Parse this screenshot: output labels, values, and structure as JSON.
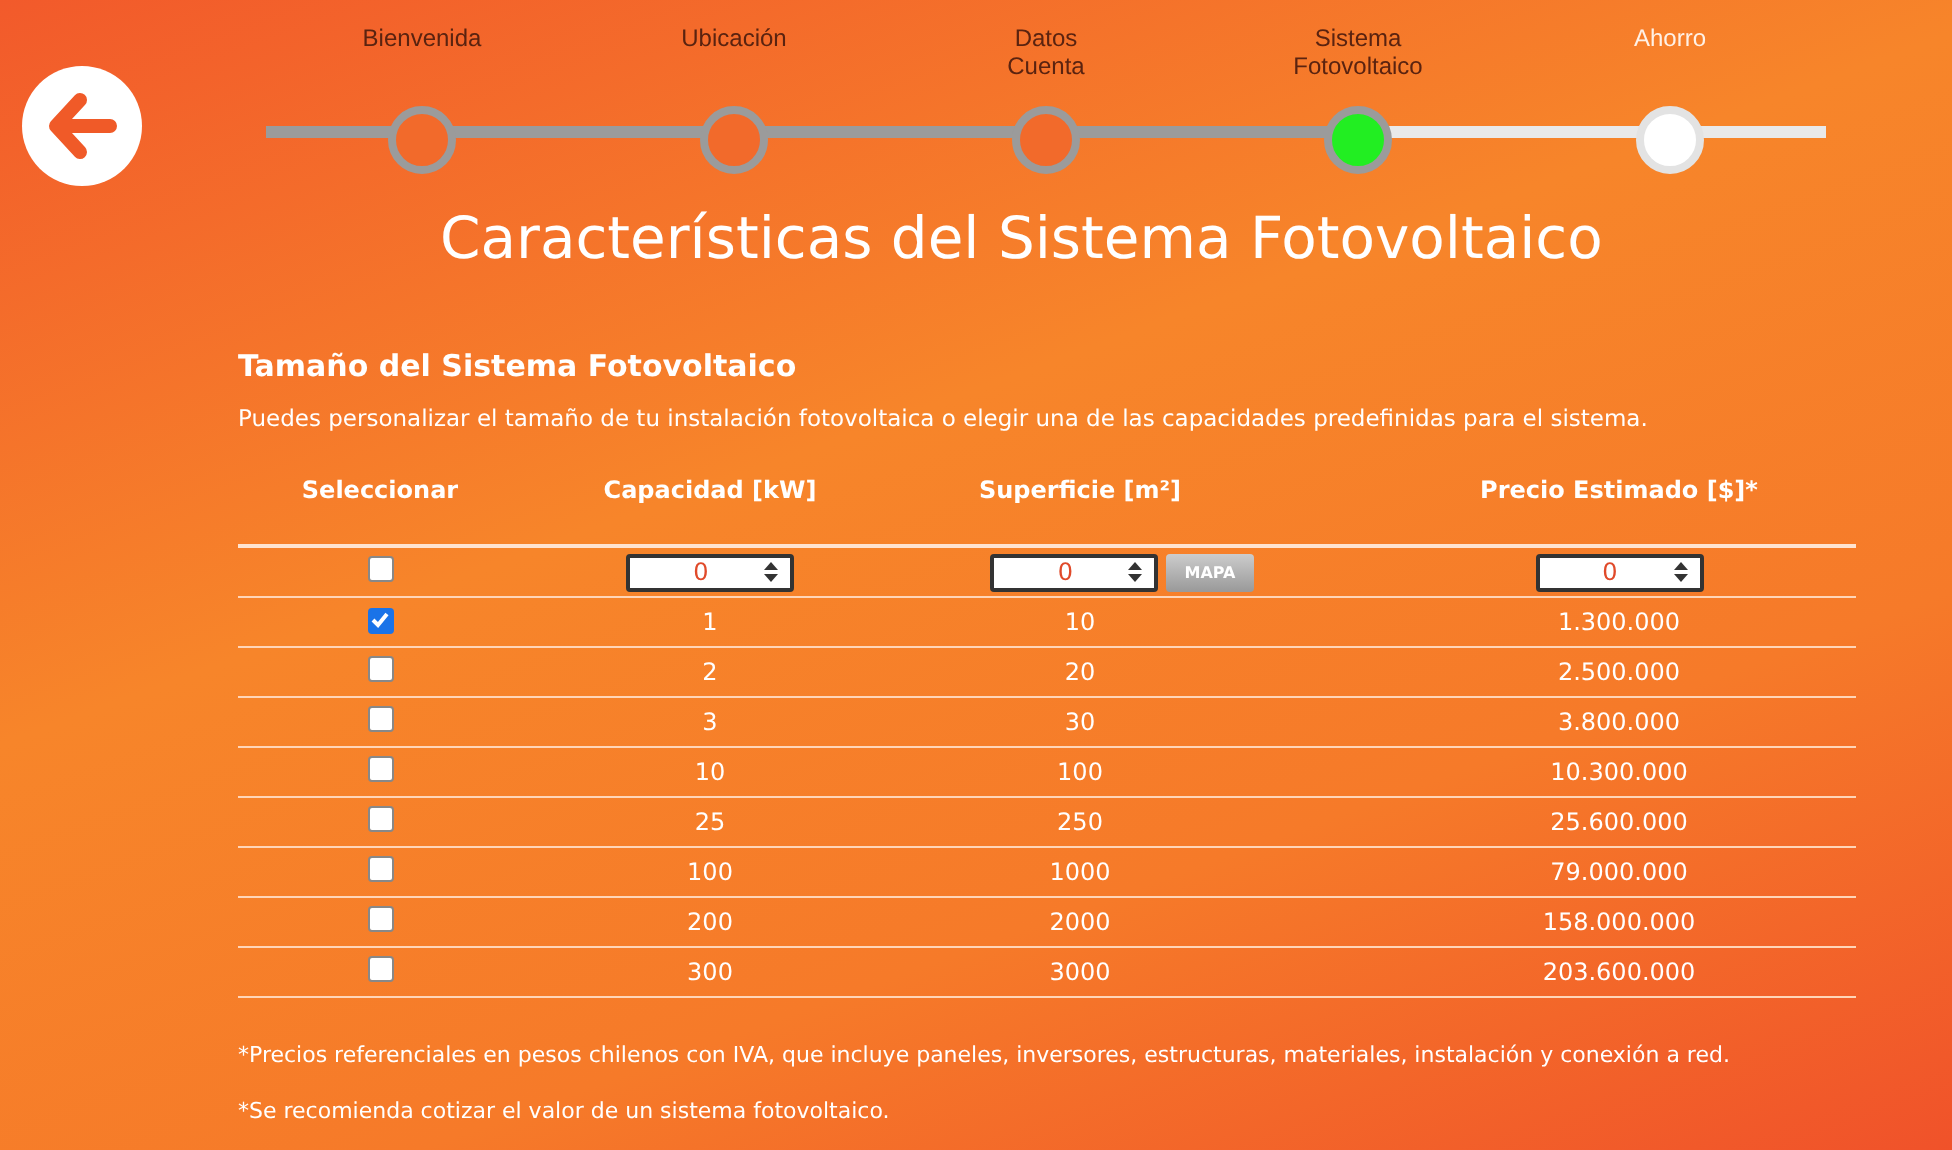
{
  "steps": [
    {
      "label": "Bienvenida",
      "completed": true,
      "selected": false
    },
    {
      "label": "Ubicación",
      "completed": true,
      "selected": false
    },
    {
      "label": "Datos Cuenta",
      "completed": true,
      "selected": false
    },
    {
      "label": "Sistema Fotovoltaico",
      "completed": false,
      "selected": true
    },
    {
      "label": "Ahorro",
      "completed": false,
      "selected": false
    }
  ],
  "title": "Características del Sistema Fotovoltaico",
  "section": {
    "heading": "Tamaño del Sistema Fotovoltaico",
    "description": "Puedes personalizar el tamaño de tu instalación fotovoltaica o elegir una de las capacidades predefinidas para el sistema."
  },
  "table": {
    "columns": [
      "Seleccionar",
      "Capacidad [kW]",
      "Superficie [m²]",
      "Precio Estimado [$]*"
    ],
    "custom_row": {
      "checked": false,
      "capacity": "0",
      "surface": "0",
      "map_button": "MAPA",
      "price": "0"
    },
    "rows": [
      {
        "checked": true,
        "capacity": "1",
        "surface": "10",
        "price": "1.300.000"
      },
      {
        "checked": false,
        "capacity": "2",
        "surface": "20",
        "price": "2.500.000"
      },
      {
        "checked": false,
        "capacity": "3",
        "surface": "30",
        "price": "3.800.000"
      },
      {
        "checked": false,
        "capacity": "10",
        "surface": "100",
        "price": "10.300.000"
      },
      {
        "checked": false,
        "capacity": "25",
        "surface": "250",
        "price": "25.600.000"
      },
      {
        "checked": false,
        "capacity": "100",
        "surface": "1000",
        "price": "79.000.000"
      },
      {
        "checked": false,
        "capacity": "200",
        "surface": "2000",
        "price": "158.000.000"
      },
      {
        "checked": false,
        "capacity": "300",
        "surface": "3000",
        "price": "203.600.000"
      }
    ]
  },
  "notes": [
    "*Precios referenciales en pesos chilenos con IVA, que incluye paneles, inversores, estructuras, materiales, instalación y conexión a red.",
    "*Se recomienda cotizar el valor de un sistema fotovoltaico."
  ]
}
